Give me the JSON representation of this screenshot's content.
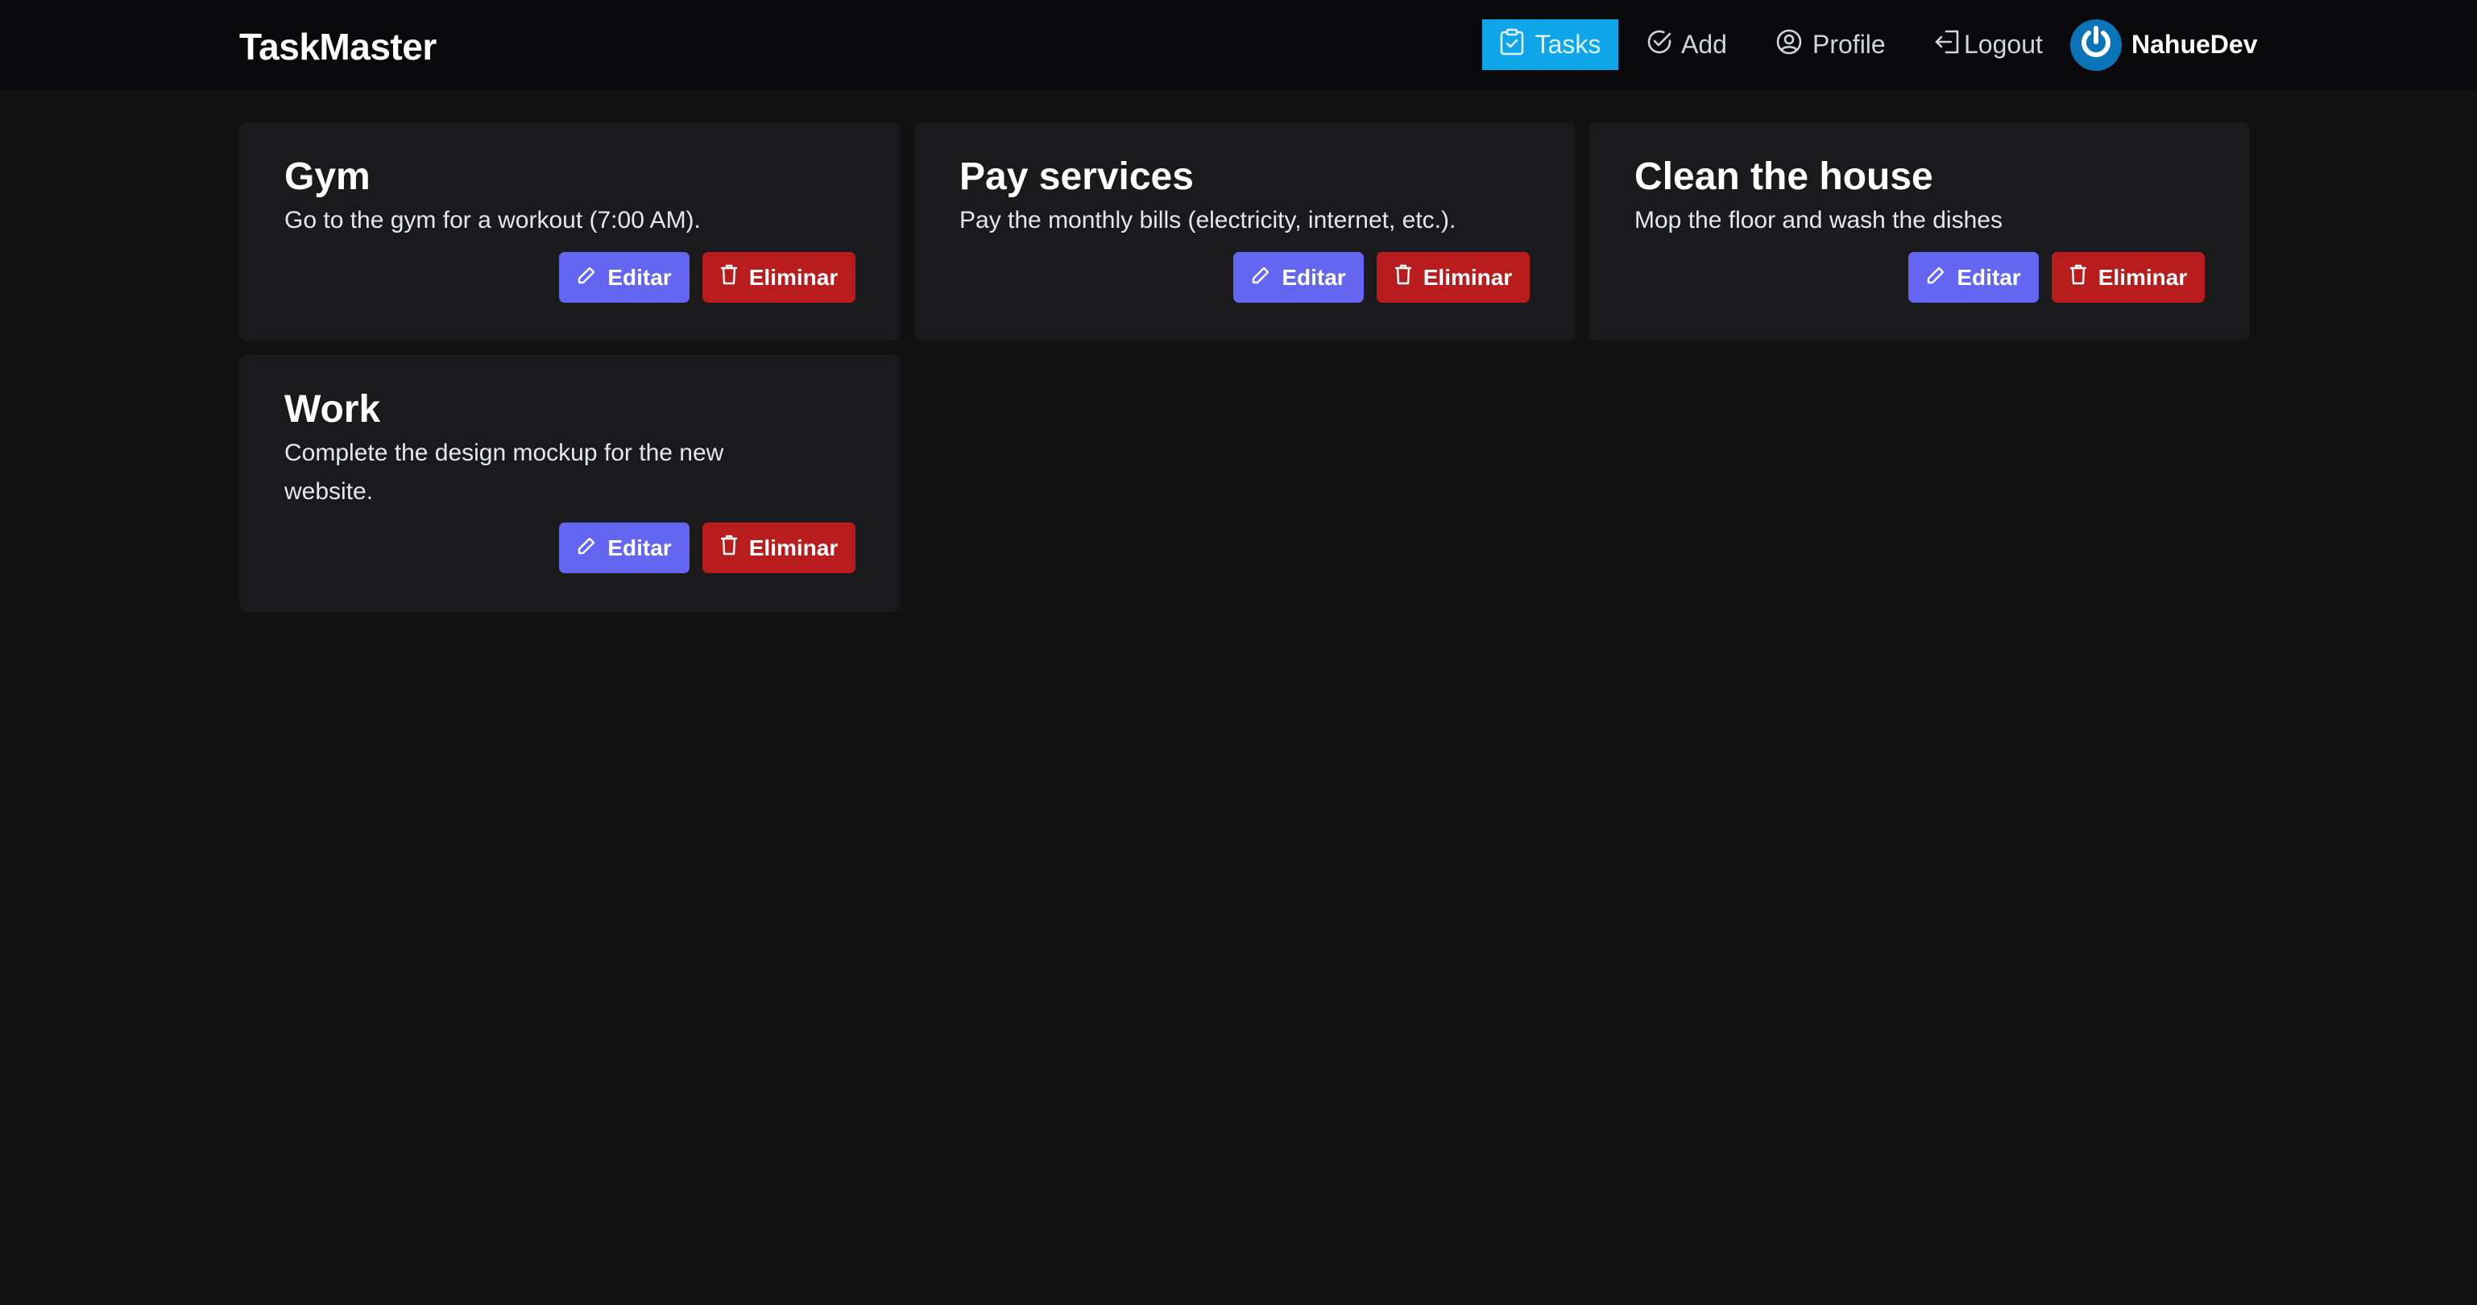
{
  "app": {
    "brand": "TaskMaster"
  },
  "nav": {
    "tasks": "Tasks",
    "add": "Add",
    "profile": "Profile",
    "logout": "Logout",
    "username": "NahueDev"
  },
  "colors": {
    "background": "#111111",
    "navbar": "#09090b",
    "card": "#1a1a1d",
    "active_tab": "#0ea5e9",
    "edit_button": "#6366f1",
    "delete_button": "#b91c1c"
  },
  "tasks": [
    {
      "title": "Gym",
      "description": "Go to the gym for a workout (7:00 AM).",
      "edit_label": "Editar",
      "delete_label": "Eliminar"
    },
    {
      "title": "Pay services",
      "description": "Pay the monthly bills (electricity, internet, etc.).",
      "edit_label": "Editar",
      "delete_label": "Eliminar"
    },
    {
      "title": "Clean the house",
      "description": "Mop the floor and wash the dishes",
      "edit_label": "Editar",
      "delete_label": "Eliminar"
    },
    {
      "title": "Work",
      "description": "Complete the design mockup for the new website.",
      "edit_label": "Editar",
      "delete_label": "Eliminar"
    }
  ]
}
